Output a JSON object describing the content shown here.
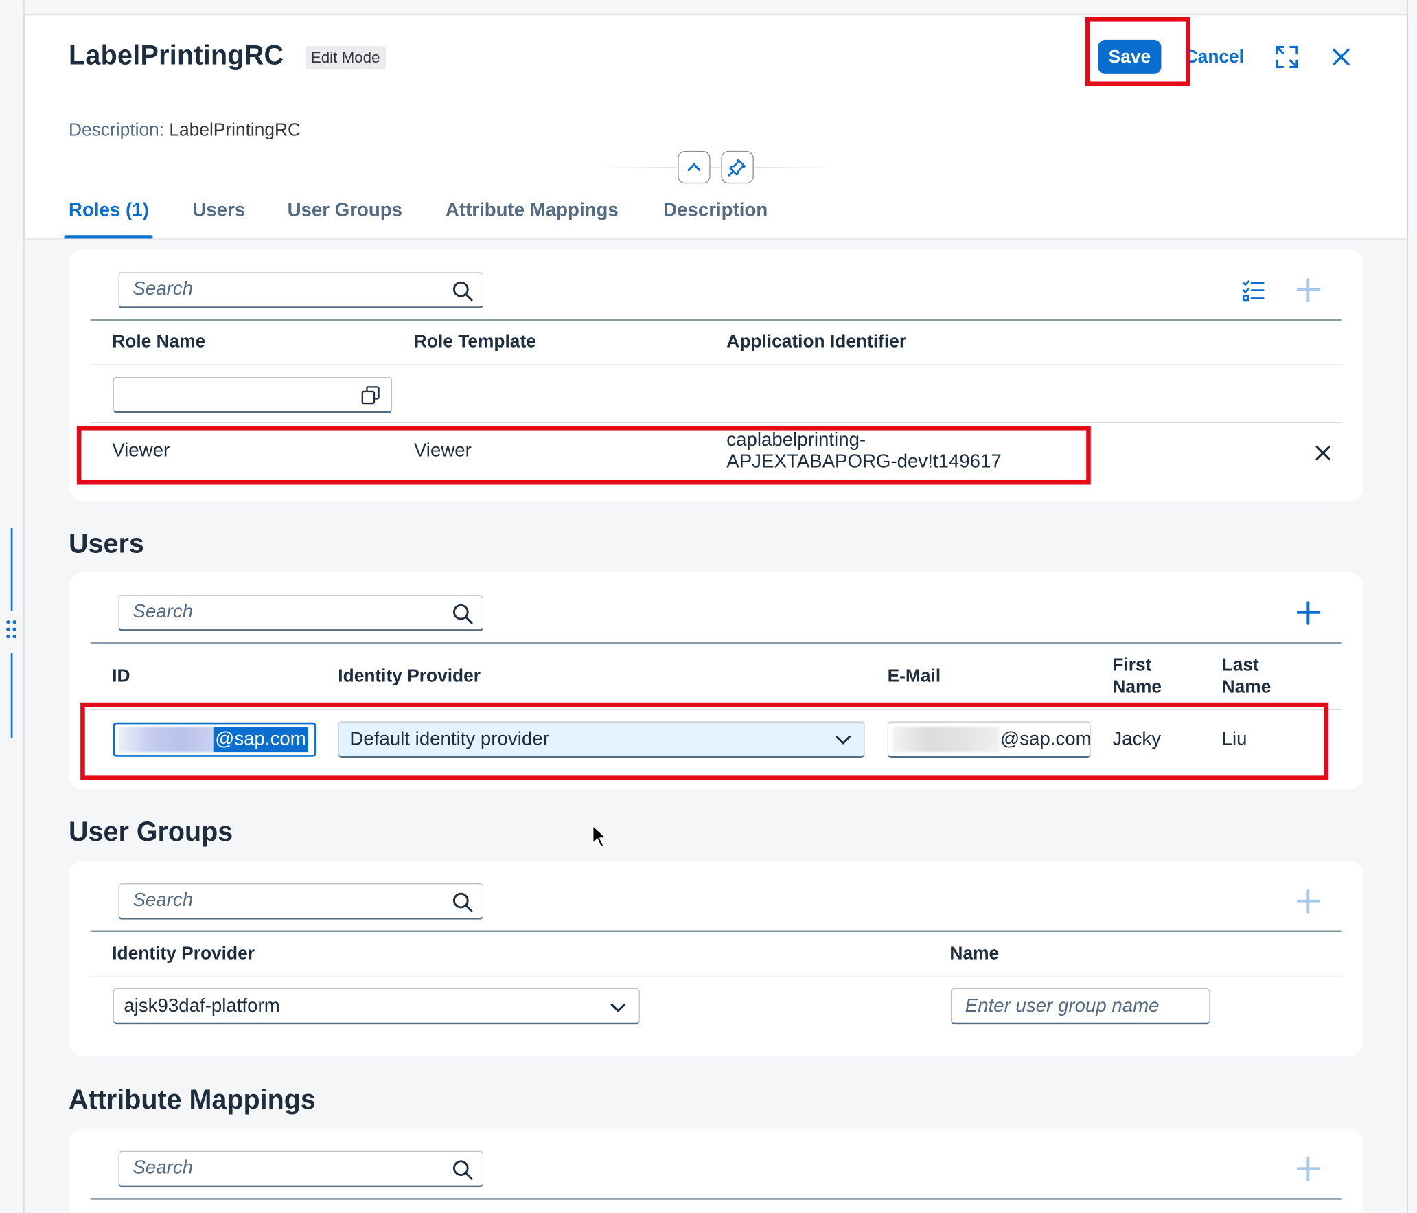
{
  "header": {
    "title": "LabelPrintingRC",
    "mode_badge": "Edit Mode",
    "save_label": "Save",
    "cancel_label": "Cancel",
    "description_label": "Description:",
    "description_value": "LabelPrintingRC"
  },
  "tabs": [
    {
      "label": "Roles (1)",
      "active": true
    },
    {
      "label": "Users"
    },
    {
      "label": "User Groups"
    },
    {
      "label": "Attribute Mappings"
    },
    {
      "label": "Description"
    }
  ],
  "roles": {
    "search_placeholder": "Search",
    "columns": [
      "Role Name",
      "Role Template",
      "Application Identifier"
    ],
    "rows": [
      {
        "role_name": "Viewer",
        "role_template": "Viewer",
        "app_id_line1": "caplabelprinting-",
        "app_id_line2": "APJEXTABAPORG-dev!t149617"
      }
    ]
  },
  "users": {
    "section_title": "Users",
    "search_placeholder": "Search",
    "columns": {
      "id": "ID",
      "idp": "Identity Provider",
      "email": "E-Mail",
      "first_name_1": "First",
      "first_name_2": "Name",
      "last_name_1": "Last",
      "last_name_2": "Name"
    },
    "row": {
      "id_value": "@sap.com",
      "idp_value": "Default identity provider",
      "email_value": "@sap.com",
      "first_name": "Jacky",
      "last_name": "Liu"
    }
  },
  "user_groups": {
    "section_title": "User Groups",
    "search_placeholder": "Search",
    "columns": [
      "Identity Provider",
      "Name"
    ],
    "idp_value": "ajsk93daf-platform",
    "name_placeholder": "Enter user group name"
  },
  "attribute_mappings": {
    "section_title": "Attribute Mappings",
    "search_placeholder": "Search"
  },
  "colors": {
    "accent": "#0a6ed1",
    "highlight_box": "#e30b17",
    "selection_bg": "#e5f3ff"
  }
}
